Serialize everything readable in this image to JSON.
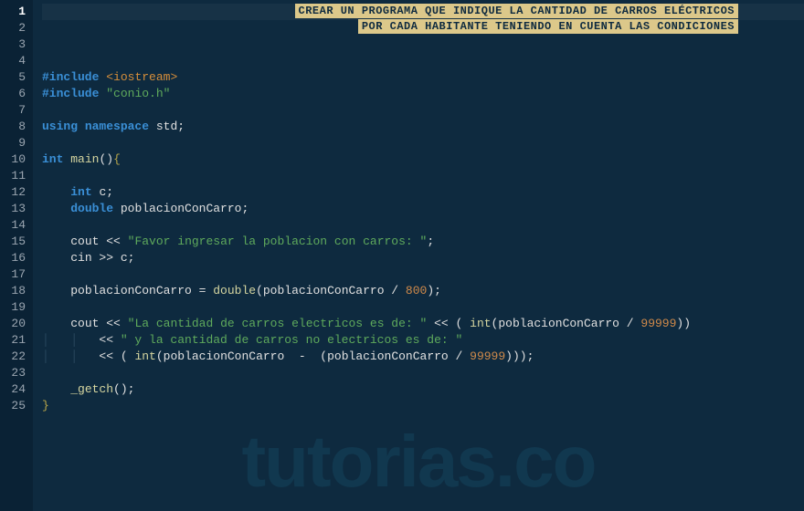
{
  "banner": {
    "line1": "CREAR UN PROGRAMA QUE INDIQUE LA CANTIDAD DE CARROS ELÉCTRICOS",
    "line2": "POR CADA HABITANTE TENIENDO EN CUENTA LAS CONDICIONES"
  },
  "watermark": "tutorias.co",
  "gutter": {
    "lines": [
      "1",
      "2",
      "3",
      "4",
      "5",
      "6",
      "7",
      "8",
      "9",
      "10",
      "11",
      "12",
      "13",
      "14",
      "15",
      "16",
      "17",
      "18",
      "19",
      "20",
      "21",
      "22",
      "23",
      "24",
      "25"
    ],
    "active": 1
  },
  "code": {
    "pp_include": "#include",
    "inc_iostream": "<iostream>",
    "inc_conio": "\"conio.h\"",
    "kw_using": "using",
    "kw_namespace": "namespace",
    "id_std": "std",
    "kw_int": "int",
    "fn_main": "main",
    "kw_double": "double",
    "id_c": "c",
    "id_pcc": "poblacionConCarro",
    "id_cout": "cout",
    "id_cin": "cin",
    "str_prompt": "\"Favor ingresar la poblacion con carros: \"",
    "str_elec": "\"La cantidad de carros electricos es de: \"",
    "str_noelec": "\" y la cantidad de carros no electricos es de: \"",
    "num_800": "800",
    "num_99999a": "99999",
    "num_99999b": "99999",
    "fn_double": "double",
    "fn_int": "int",
    "fn_getch": "_getch",
    "semi": ";",
    "op_assign": " = ",
    "op_ins": " << ",
    "op_ins2": "<< ",
    "op_ext": " >> ",
    "op_div": " / ",
    "op_sub": "  -  ",
    "brace_open": "{",
    "brace_close": "}",
    "paren_open": "(",
    "paren_close": ")",
    "paren_open_sp": "( ",
    "indent1": "    ",
    "indent2": "        ",
    "guide1": "│   ",
    "guide2": "│   │   "
  }
}
